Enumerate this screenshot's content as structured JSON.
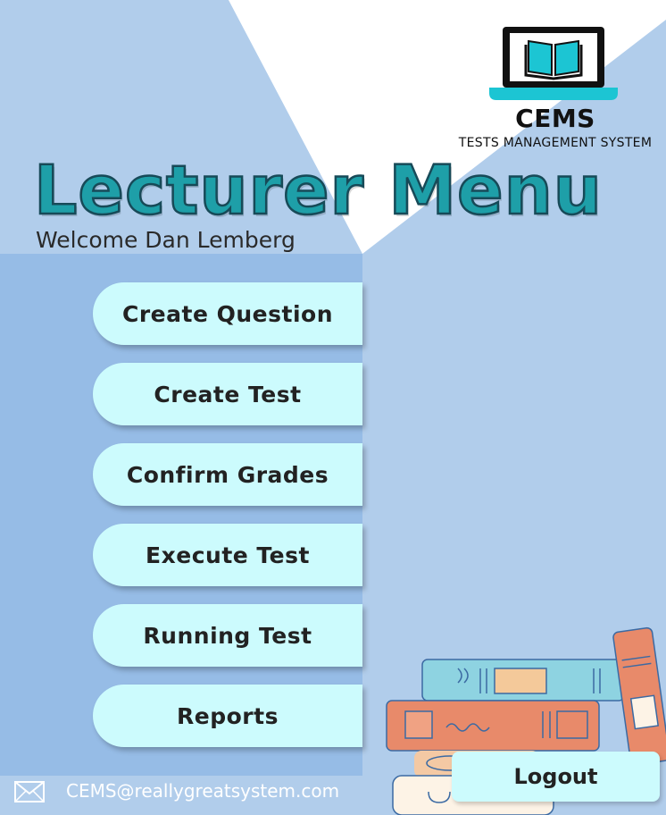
{
  "brand": {
    "name": "CEMS",
    "subtitle": "TESTS MANAGEMENT SYSTEM"
  },
  "page": {
    "title": "Lecturer Menu",
    "welcome": "Welcome Dan Lemberg"
  },
  "menu": {
    "create_question": "Create Question",
    "create_test": "Create Test",
    "confirm_grades": "Confirm Grades",
    "execute_test": "Execute Test",
    "running_test": "Running Test",
    "reports": "Reports"
  },
  "footer": {
    "email": "CEMS@reallygreatsystem.com",
    "email_icon": "mail-icon"
  },
  "logout_label": "Logout",
  "colors": {
    "background": "#b1cdeb",
    "panel": "#96bce6",
    "button": "#ccfbfd",
    "title": "#1e9fa8",
    "logo_accent": "#1cc5d3"
  }
}
